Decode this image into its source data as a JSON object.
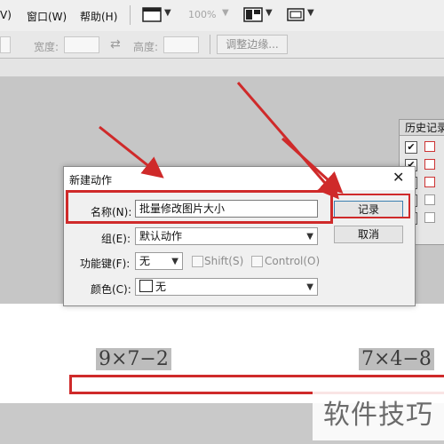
{
  "menubar": {
    "items": [
      "V)",
      "窗口(W)",
      "帮助(H)"
    ],
    "zoom": "100%",
    "icons": [
      "film-frame-icon",
      "arrange-windows-icon",
      "screen-mode-icon"
    ]
  },
  "optionsbar": {
    "width_label": "宽度:",
    "height_label": "高度:",
    "swap_icon": "⇄",
    "adjust_button": "调整边缘..."
  },
  "history_panel": {
    "title": "历史记录"
  },
  "dialog": {
    "title": "新建动作",
    "name_label": "名称(N):",
    "name_value": "批量修改图片大小",
    "group_label": "组(E):",
    "group_value": "默认动作",
    "fkey_label": "功能键(F):",
    "fkey_value": "无",
    "shift_label": "Shift(S)",
    "control_label": "Control(O)",
    "color_label": "颜色(C):",
    "color_value": "无",
    "record_button": "记录",
    "cancel_button": "取消"
  },
  "document": {
    "expr_left": "9×7−2",
    "expr_right": "7×4−8"
  },
  "watermark": "软件技巧",
  "colors": {
    "annotation_red": "#cf2a2a",
    "dialog_bg": "#f0f0f0"
  }
}
